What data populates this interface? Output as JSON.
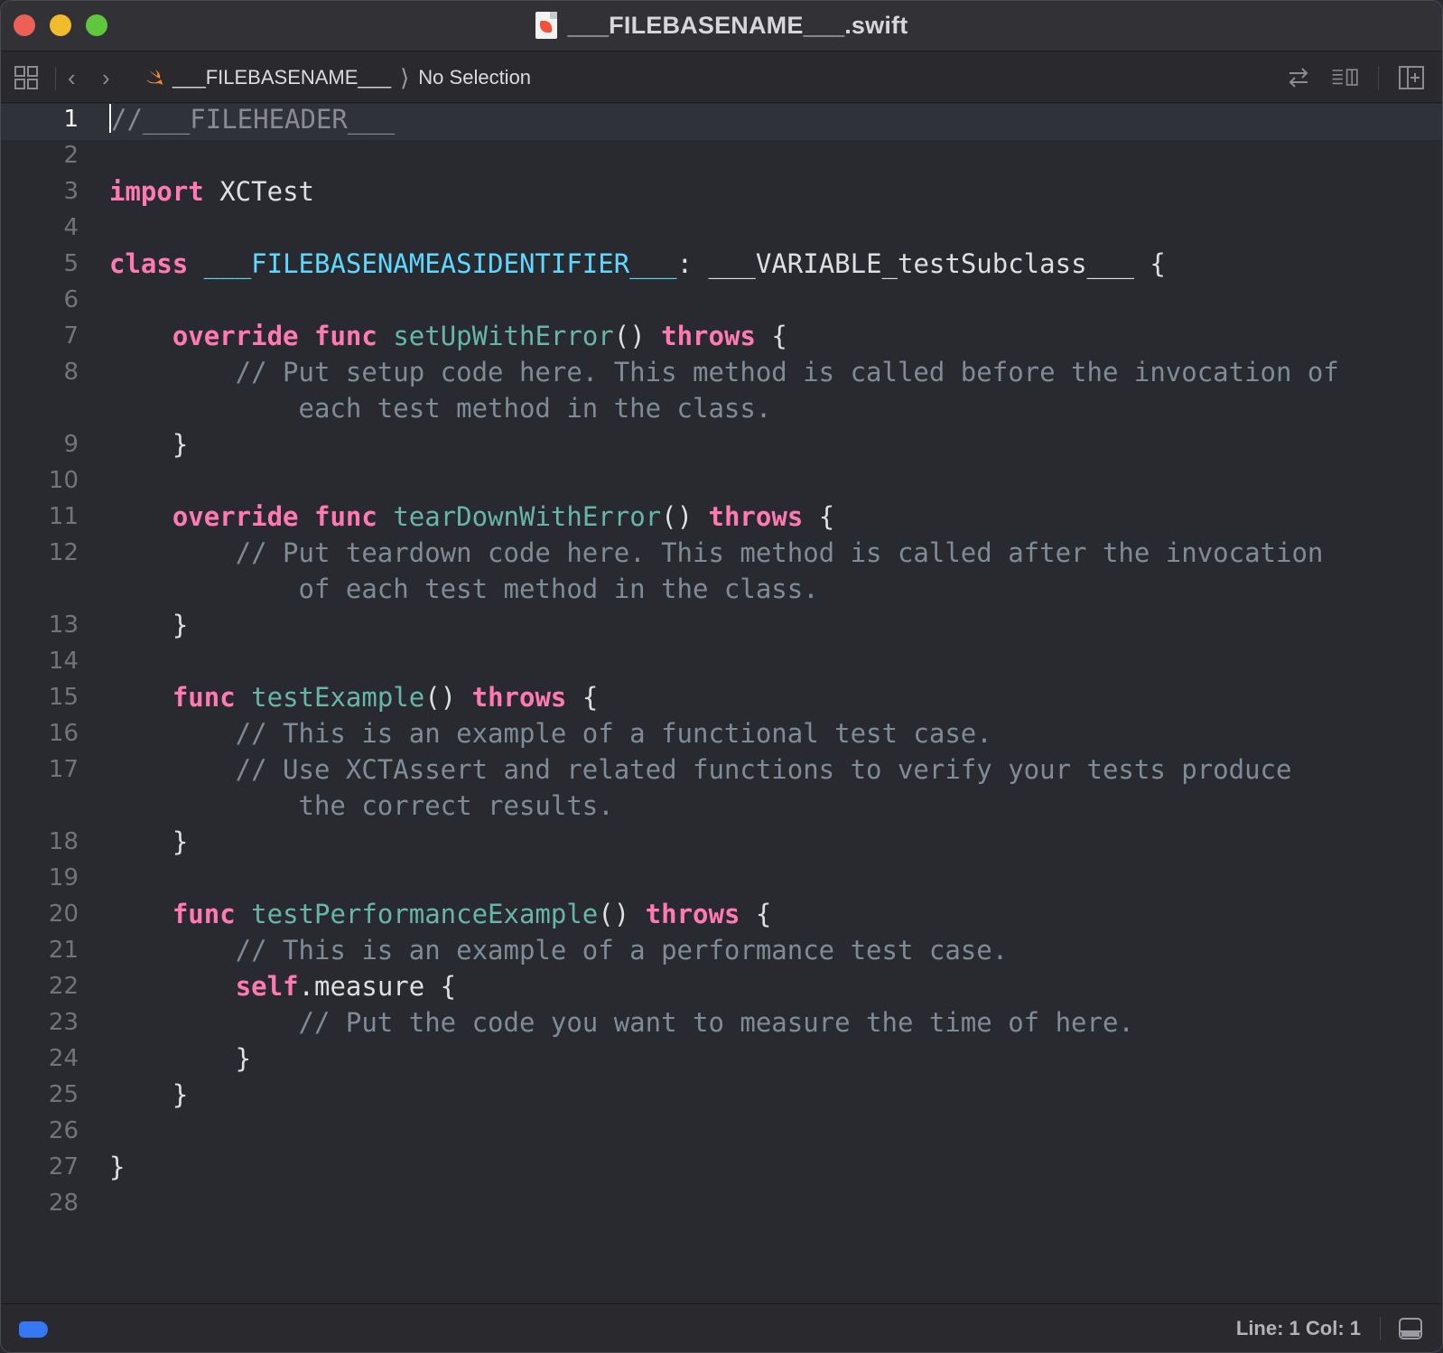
{
  "window": {
    "title": "___FILEBASENAME___.swift"
  },
  "jumpbar": {
    "crumb_file": "___FILEBASENAME___",
    "crumb_selection": "No Selection"
  },
  "editor": {
    "lines": [
      {
        "n": "1",
        "text": "//___FILEHEADER___"
      },
      {
        "n": "2",
        "text": ""
      },
      {
        "n": "3",
        "text": "import XCTest"
      },
      {
        "n": "4",
        "text": ""
      },
      {
        "n": "5",
        "text": "class ___FILEBASENAMEASIDENTIFIER___: ___VARIABLE_testSubclass___ {"
      },
      {
        "n": "6",
        "text": ""
      },
      {
        "n": "7",
        "text": "    override func setUpWithError() throws {"
      },
      {
        "n": "8",
        "text": "        // Put setup code here. This method is called before the invocation of",
        "wrap": "            each test method in the class."
      },
      {
        "n": "9",
        "text": "    }"
      },
      {
        "n": "10",
        "text": ""
      },
      {
        "n": "11",
        "text": "    override func tearDownWithError() throws {"
      },
      {
        "n": "12",
        "text": "        // Put teardown code here. This method is called after the invocation",
        "wrap": "            of each test method in the class."
      },
      {
        "n": "13",
        "text": "    }"
      },
      {
        "n": "14",
        "text": ""
      },
      {
        "n": "15",
        "text": "    func testExample() throws {"
      },
      {
        "n": "16",
        "text": "        // This is an example of a functional test case."
      },
      {
        "n": "17",
        "text": "        // Use XCTAssert and related functions to verify your tests produce",
        "wrap": "            the correct results."
      },
      {
        "n": "18",
        "text": "    }"
      },
      {
        "n": "19",
        "text": ""
      },
      {
        "n": "20",
        "text": "    func testPerformanceExample() throws {"
      },
      {
        "n": "21",
        "text": "        // This is an example of a performance test case."
      },
      {
        "n": "22",
        "text": "        self.measure {"
      },
      {
        "n": "23",
        "text": "            // Put the code you want to measure the time of here."
      },
      {
        "n": "24",
        "text": "        }"
      },
      {
        "n": "25",
        "text": "    }"
      },
      {
        "n": "26",
        "text": ""
      },
      {
        "n": "27",
        "text": "}"
      },
      {
        "n": "28",
        "text": ""
      }
    ]
  },
  "status": {
    "position": "Line: 1  Col: 1"
  },
  "colors": {
    "keyword": "#ff7ab2",
    "comment": "#7f8c98",
    "function": "#67b7a4",
    "type": "#5dd8ff",
    "background": "#292a30"
  }
}
